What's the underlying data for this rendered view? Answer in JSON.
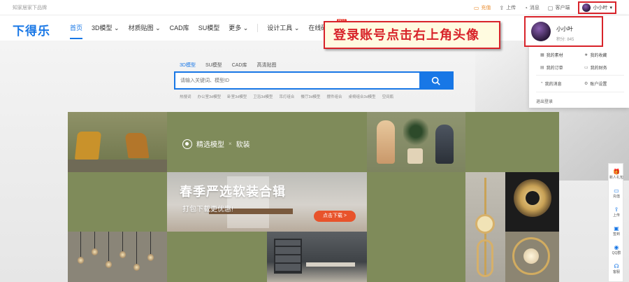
{
  "topbar": {
    "brand_text": "知家居家下品牌",
    "links": [
      {
        "label": "充值",
        "icon": "wallet-icon"
      },
      {
        "label": "上传",
        "icon": "upload-icon"
      },
      {
        "label": "消息",
        "icon": "bell-icon"
      },
      {
        "label": "客户端",
        "icon": "monitor-icon"
      }
    ],
    "user_label": "小小叶"
  },
  "header": {
    "logo": "下得乐",
    "nav": [
      {
        "label": "首页",
        "active": true
      },
      {
        "label": "3D模型"
      },
      {
        "label": "材质贴图"
      },
      {
        "label": "CAD库"
      },
      {
        "label": "SU模型"
      },
      {
        "label": "更多"
      },
      {
        "label": "设计工具"
      },
      {
        "label": "在线砖版本",
        "badge": "HOT"
      }
    ]
  },
  "search": {
    "tabs": [
      "3D模型",
      "SU模型",
      "CAD库",
      "高清贴图"
    ],
    "active_tab": "3D模型",
    "placeholder": "请输入关键词、模型ID",
    "hotwords": [
      "热搜词",
      "办公室3d模型",
      "卧室3d模型",
      "卫浴3d模型",
      "吊灯组合",
      "餐厅3d模型",
      "摆件组合",
      "桌椅组合3d模型",
      "空间瓶"
    ]
  },
  "banner": {
    "brand": "精选模型",
    "cross": "×",
    "category": "软装",
    "title": "春季严选软装合辑",
    "subtitle": "打包下载更优惠!",
    "cta": "点击下载 >"
  },
  "annotation": "登录账号点击右上角头像",
  "user_menu": {
    "name": "小小叶",
    "points": "积分: 845",
    "items": [
      {
        "label": "我的素材",
        "icon": "grid-icon"
      },
      {
        "label": "我的收藏",
        "icon": "star-icon"
      },
      {
        "label": "我的订单",
        "icon": "doc-icon"
      },
      {
        "label": "我的财务",
        "icon": "wallet-icon"
      },
      {
        "label": "我的消息",
        "icon": "bell-icon"
      },
      {
        "label": "账户设置",
        "icon": "gear-icon"
      }
    ],
    "logout": "退出登录"
  },
  "sidebar": [
    {
      "label": "新人礼包",
      "icon": "gift-icon"
    },
    {
      "label": "充值",
      "icon": "wallet-icon"
    },
    {
      "label": "上传",
      "icon": "upload-icon"
    },
    {
      "label": "签到",
      "icon": "calendar-icon"
    },
    {
      "label": "QQ群",
      "icon": "qq-icon"
    },
    {
      "label": "客服",
      "icon": "headset-icon"
    }
  ],
  "colors": {
    "accent": "#1877e6",
    "annotation": "#d8232a",
    "banner": "#7f8b5a",
    "cta": "#e8532b"
  }
}
